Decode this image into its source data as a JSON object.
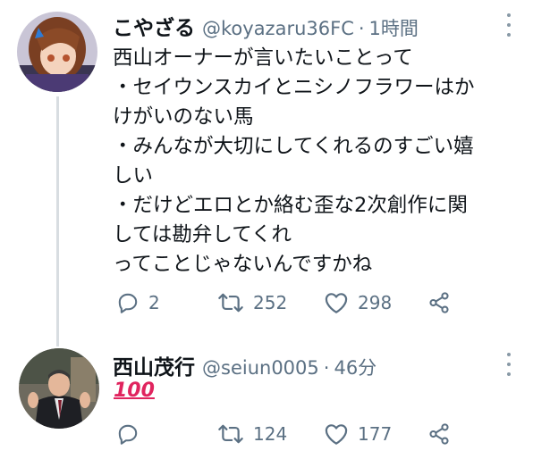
{
  "tweet1": {
    "name": "こやざる",
    "handle": "@koyazaru36FC",
    "separator": "·",
    "time": "1時間",
    "lines": [
      "西山オーナーが言いたいことって",
      "・セイウンスカイとニシノフラワーはか",
      "けがいのない馬",
      "・みんなが大切にしてくれるのすごい嬉",
      "しい",
      "・だけどエロとか絡む歪な2次創作に関",
      "しては勘弁してくれ",
      "ってことじゃないんですかね"
    ],
    "replies": "2",
    "retweets": "252",
    "likes": "298"
  },
  "tweet2": {
    "name": "西山茂行",
    "handle": "@seiun0005",
    "separator": "·",
    "time": "46分",
    "emoji": "💯",
    "emoji_text": "100",
    "replies": "",
    "retweets": "124",
    "likes": "177"
  },
  "icons": [
    "reply-icon",
    "retweet-icon",
    "like-icon",
    "share-icon",
    "more-icon"
  ],
  "colors": {
    "text": "#0f1419",
    "secondary": "#5b7083",
    "thread_line": "#d8dde1",
    "emoji_100": "#e0245e"
  }
}
